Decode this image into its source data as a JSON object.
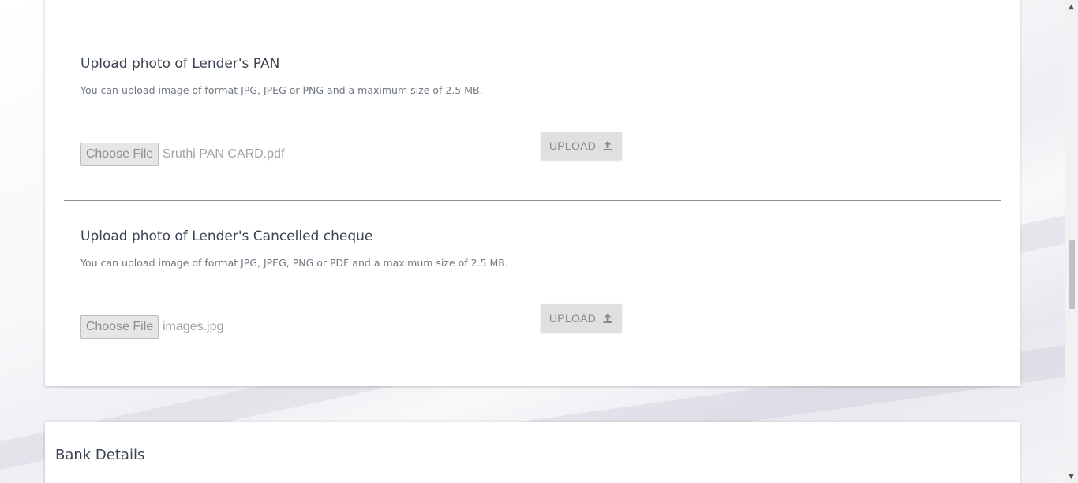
{
  "sections": [
    {
      "title": "Upload photo of Lender's PAN",
      "description": "You can upload image of format JPG, JPEG or PNG and a maximum size of 2.5 MB.",
      "choose_label": "Choose File",
      "file_name": "Sruthi PAN  CARD.pdf",
      "upload_label": "UPLOAD"
    },
    {
      "title": "Upload photo of Lender's Cancelled cheque",
      "description": "You can upload image of format JPG, JPEG, PNG or PDF and a maximum size of 2.5 MB.",
      "choose_label": "Choose File",
      "file_name": "images.jpg",
      "upload_label": "UPLOAD"
    }
  ],
  "bank": {
    "title": "Bank Details"
  },
  "icons": {
    "upload": "upload-icon",
    "scroll_up": "scroll-up-arrow-icon",
    "scroll_down": "scroll-down-arrow-icon"
  },
  "colors": {
    "title": "#3b4451",
    "description": "#6f7781",
    "divider": "#8f8f8f",
    "button_bg": "#e0e0e0",
    "button_text": "#8a8a8a"
  }
}
